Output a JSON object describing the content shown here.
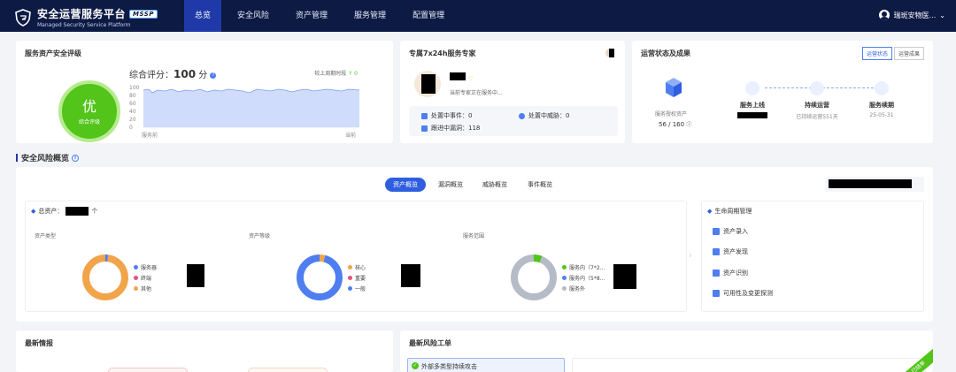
{
  "app": {
    "title": "安全运营服务平台",
    "badge": "MSSP",
    "subtitle": "Managed Security Service Platform",
    "user": "瑞斑安物医..."
  },
  "nav": [
    {
      "label": "总览",
      "active": true
    },
    {
      "label": "安全风险",
      "active": false
    },
    {
      "label": "资产管理",
      "active": false
    },
    {
      "label": "服务管理",
      "active": false
    },
    {
      "label": "配置管理",
      "active": false
    }
  ],
  "security_eval": {
    "title": "服务资产安全评级",
    "grade": "优",
    "grade_label": "综合评级",
    "score_label": "综合评分：",
    "score": "100",
    "score_unit": "分",
    "compare_label": "较上周期时段",
    "compare_value": "0",
    "x_start": "服务前",
    "x_end": "当前",
    "y_ticks": [
      "100",
      "80",
      "60",
      "40",
      "20",
      "0"
    ]
  },
  "expert": {
    "title": "专属7x24h服务专家",
    "status": "当前专家正在服务中...",
    "items": [
      {
        "label": "处置中事件：",
        "value": "0"
      },
      {
        "label": "处置中威胁：",
        "value": "0"
      },
      {
        "label": "跟进中漏洞：",
        "value": "118"
      }
    ]
  },
  "ops": {
    "title": "运营状态及成果",
    "tabs": [
      "运营状态",
      "运营成果"
    ],
    "assets_label": "服务授权资产",
    "assets_value": "56 / 160",
    "steps": [
      {
        "label": "服务上线",
        "sub": ""
      },
      {
        "label": "持续运营",
        "sub": "已持续运营551天"
      },
      {
        "label": "服务续期",
        "sub": "25-05-31"
      }
    ]
  },
  "risk_overview": {
    "title": "安全风险概览",
    "tabs": [
      "资产概览",
      "漏洞概览",
      "威胁概览",
      "事件概览"
    ],
    "active_tab": 0
  },
  "assets": {
    "total_label": "总资产：",
    "total_unit": "个",
    "charts": [
      {
        "title": "资产类型",
        "legend": [
          "服务器",
          "终端",
          "其他"
        ],
        "colors": [
          "#4f7ef0",
          "#e6507d",
          "#f2a44a"
        ],
        "values": [
          0.02,
          0.0,
          0.98
        ]
      },
      {
        "title": "资产等级",
        "legend": [
          "核心",
          "重要",
          "一般"
        ],
        "colors": [
          "#f2a44a",
          "#e6507d",
          "#4f7ef0"
        ],
        "values": [
          0.04,
          0.0,
          0.96
        ]
      },
      {
        "title": "服务范围",
        "legend": [
          "服务内（7*2...",
          "服务内（5*8...",
          "服务外"
        ],
        "colors": [
          "#52c41a",
          "#4f7ef0",
          "#b5bcc8"
        ],
        "values": [
          0.06,
          0.0,
          0.94
        ]
      }
    ]
  },
  "lifecycle": {
    "title": "生命周期管理",
    "items": [
      "资产录入",
      "资产发现",
      "资产识别",
      "可用性及变更探测"
    ]
  },
  "latest_intel": {
    "title": "最新情报"
  },
  "risk_tickets": {
    "title": "最新风险工单",
    "item": "外部多类型持续攻击",
    "corner": "已结单"
  }
}
